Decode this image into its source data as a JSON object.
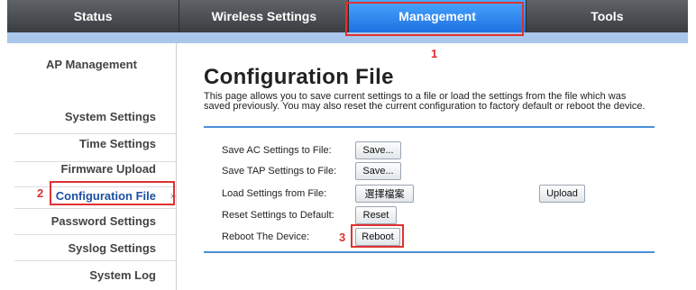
{
  "nav": {
    "tabs": [
      {
        "label": "Status"
      },
      {
        "label": "Wireless Settings"
      },
      {
        "label": "Management"
      },
      {
        "label": "Tools"
      }
    ],
    "active": "Management"
  },
  "sidebar": {
    "items": [
      {
        "label": "AP Management"
      },
      {
        "label": "System Settings"
      },
      {
        "label": "Time Settings"
      },
      {
        "label": "Firmware Upload"
      },
      {
        "label": "Configuration File"
      },
      {
        "label": "Password Settings"
      },
      {
        "label": "Syslog Settings"
      },
      {
        "label": "System Log"
      }
    ],
    "active_index": 4,
    "active_marker": "»"
  },
  "main": {
    "title": "Configuration File",
    "description": "This page allows you to save current settings to a file or load the settings from the file which was saved previously. You may also reset the current configuration to factory default or reboot the device.",
    "rows": [
      {
        "label": "Save AC Settings to File:",
        "button": "Save..."
      },
      {
        "label": "Save TAP Settings to File:",
        "button": "Save..."
      },
      {
        "label": "Load Settings from File:",
        "button": "選擇檔案",
        "extra_button": "Upload"
      },
      {
        "label": "Reset Settings to Default:",
        "button": "Reset"
      },
      {
        "label": "Reboot The Device:",
        "button": "Reboot"
      }
    ]
  },
  "annotations": {
    "one": "1",
    "two": "2",
    "three": "3",
    "color": "#e03131"
  }
}
